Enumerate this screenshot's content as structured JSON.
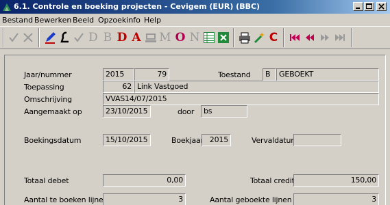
{
  "window": {
    "title": "6.1. Controle en boeking projecten - Cevigem (EUR) (BBC)",
    "icon": "app-icon"
  },
  "menu": [
    "Bestand",
    "Bewerken",
    "Beeld",
    "Opzoekinfo",
    "Help"
  ],
  "toolbar": {
    "letters": {
      "d": "D",
      "b": "B",
      "d2": "D",
      "a": "A",
      "m": "M",
      "o": "O",
      "n": "N",
      "c": "C"
    },
    "colors": {
      "disabled": "#9a9a9a",
      "red": "#c00000",
      "blue": "#1a3cc8",
      "purple": "#b00050",
      "green": "#1f8a3a"
    }
  },
  "form": {
    "jaar_nummer": {
      "label": "Jaar/nummer",
      "jaar": "2015",
      "nummer": "79"
    },
    "toestand": {
      "label": "Toestand",
      "code": "B",
      "text": "GEBOEKT"
    },
    "toepassing": {
      "label": "Toepassing",
      "code": "62",
      "name": "Link Vastgoed"
    },
    "omschrijving": {
      "label": "Omschrijving",
      "value": "VVAS14/07/2015"
    },
    "aangemaakt": {
      "label": "Aangemaakt op",
      "value": "23/10/2015",
      "door_label": "door",
      "door": "bs"
    },
    "boekingsdatum": {
      "label": "Boekingsdatum",
      "value": "15/10/2015"
    },
    "boekjaar": {
      "label": "Boekjaar",
      "value": "2015"
    },
    "vervaldatum": {
      "label": "Vervaldatum",
      "value": ""
    },
    "totaal_debet": {
      "label": "Totaal debet",
      "value": "0,00"
    },
    "totaal_credit": {
      "label": "Totaal credit",
      "value": "150,00"
    },
    "aantal_te_boeken": {
      "label": "Aantal te boeken lijnen",
      "value": "3"
    },
    "aantal_geboekt": {
      "label": "Aantal geboekte lijnen",
      "value": "3"
    }
  }
}
